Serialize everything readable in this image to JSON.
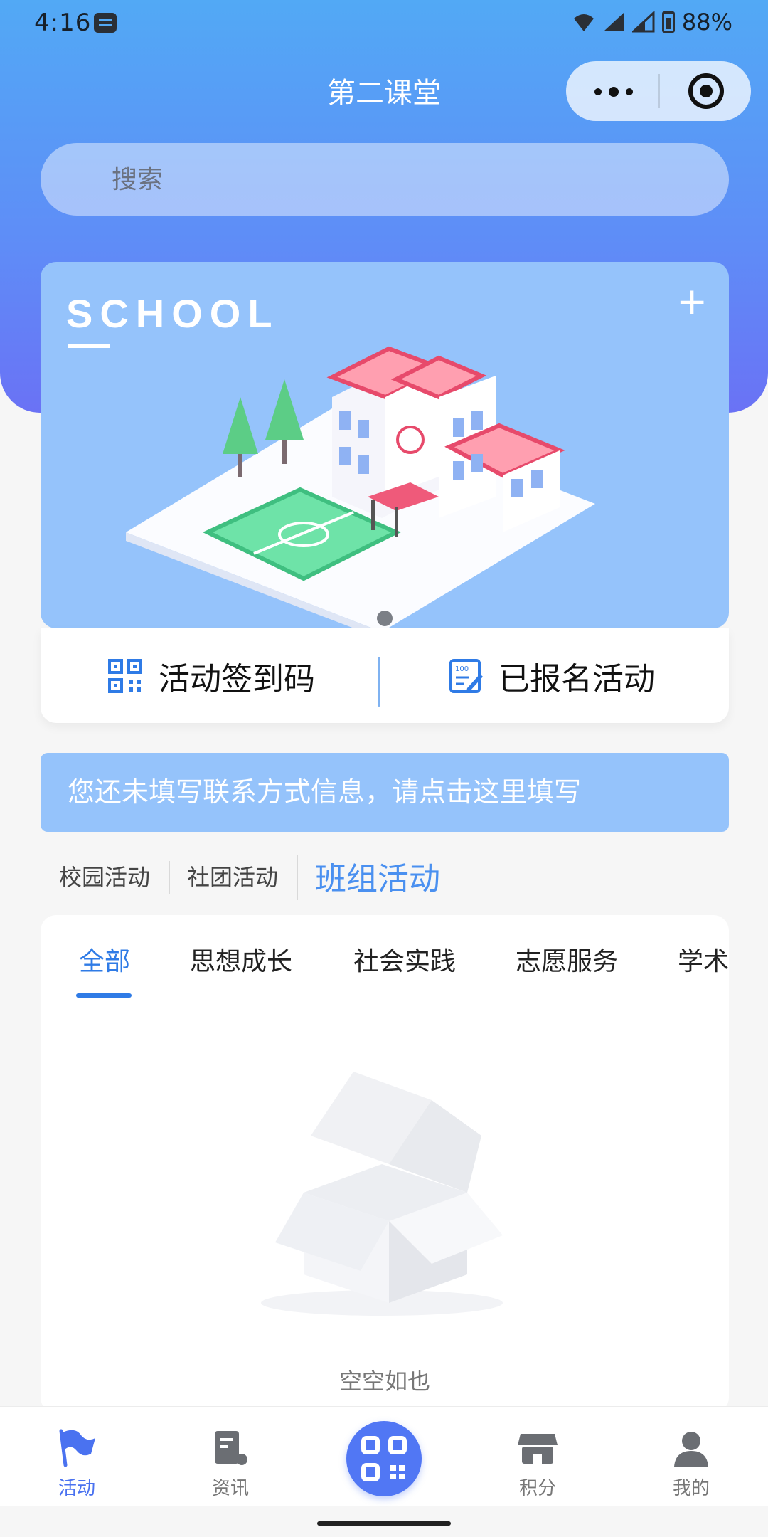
{
  "status_bar": {
    "time": "4:16",
    "battery": "88%"
  },
  "header": {
    "title": "第二课堂",
    "capsule_more_icon": "more-icon",
    "capsule_close_icon": "target-icon"
  },
  "search": {
    "placeholder": "搜索"
  },
  "banner": {
    "brand_text": "SCHOOL",
    "plus": "+",
    "image": "school-illustration"
  },
  "quick_actions": {
    "checkin_label": "活动签到码",
    "registered_label": "已报名活动"
  },
  "notice": {
    "text": "您还未填写联系方式信息，请点击这里填写"
  },
  "categories": [
    "校园活动",
    "社团活动",
    "班组活动"
  ],
  "active_category": "班组活动",
  "sub_tabs": [
    "全部",
    "思想成长",
    "社会实践",
    "志愿服务",
    "学术"
  ],
  "active_sub_tab": "全部",
  "empty": {
    "text": "空空如也"
  },
  "tabbar": {
    "items": [
      {
        "label": "活动",
        "icon": "flag-icon",
        "active": true
      },
      {
        "label": "资讯",
        "icon": "news-icon",
        "active": false
      },
      {
        "label": "",
        "icon": "qr-scan-icon",
        "active": false
      },
      {
        "label": "积分",
        "icon": "store-icon",
        "active": false
      },
      {
        "label": "我的",
        "icon": "person-icon",
        "active": false
      }
    ]
  },
  "colors": {
    "accent": "#2f7be6",
    "hero_top": "#52a9f5",
    "hero_bottom": "#6a72f5",
    "banner": "#95c3fb",
    "scan_button": "#5177f4"
  }
}
